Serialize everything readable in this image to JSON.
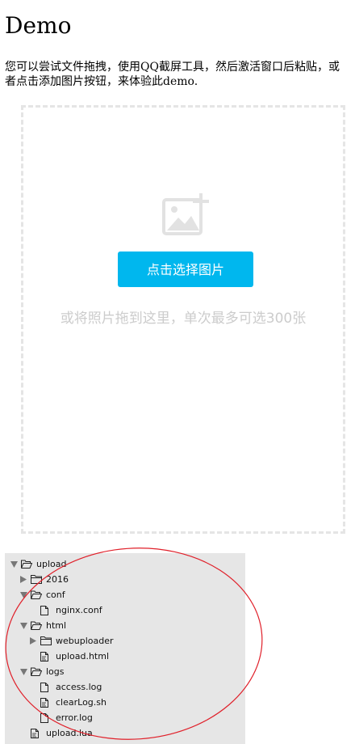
{
  "header": {
    "title": "Demo"
  },
  "intro_text": "您可以尝试文件拖拽，使用QQ截屏工具，然后激活窗口后粘贴，或者点击添加图片按钮，来体验此demo.",
  "uploader": {
    "button_label": "点击选择图片",
    "hint": "或将照片拖到这里，单次最多可选300张",
    "image_icon": "add-image-icon",
    "accent_color": "#00b7ee"
  },
  "file_tree": {
    "nodes": [
      {
        "label": "upload",
        "type": "folder",
        "state": "expanded",
        "depth": 0
      },
      {
        "label": "2016",
        "type": "folder",
        "state": "collapsed",
        "depth": 1
      },
      {
        "label": "conf",
        "type": "folder",
        "state": "expanded",
        "depth": 1
      },
      {
        "label": "nginx.conf",
        "type": "file",
        "depth": 2
      },
      {
        "label": "html",
        "type": "folder",
        "state": "expanded",
        "depth": 1
      },
      {
        "label": "webuploader",
        "type": "folder",
        "state": "collapsed",
        "depth": 2
      },
      {
        "label": "upload.html",
        "type": "code-file",
        "depth": 2
      },
      {
        "label": "logs",
        "type": "folder",
        "state": "expanded",
        "depth": 1
      },
      {
        "label": "access.log",
        "type": "file",
        "depth": 2
      },
      {
        "label": "clearLog.sh",
        "type": "code-file",
        "depth": 2
      },
      {
        "label": "error.log",
        "type": "file",
        "depth": 2
      },
      {
        "label": "upload.lua",
        "type": "code-file",
        "depth": 1
      }
    ],
    "annotation_color": "#e0202a"
  }
}
